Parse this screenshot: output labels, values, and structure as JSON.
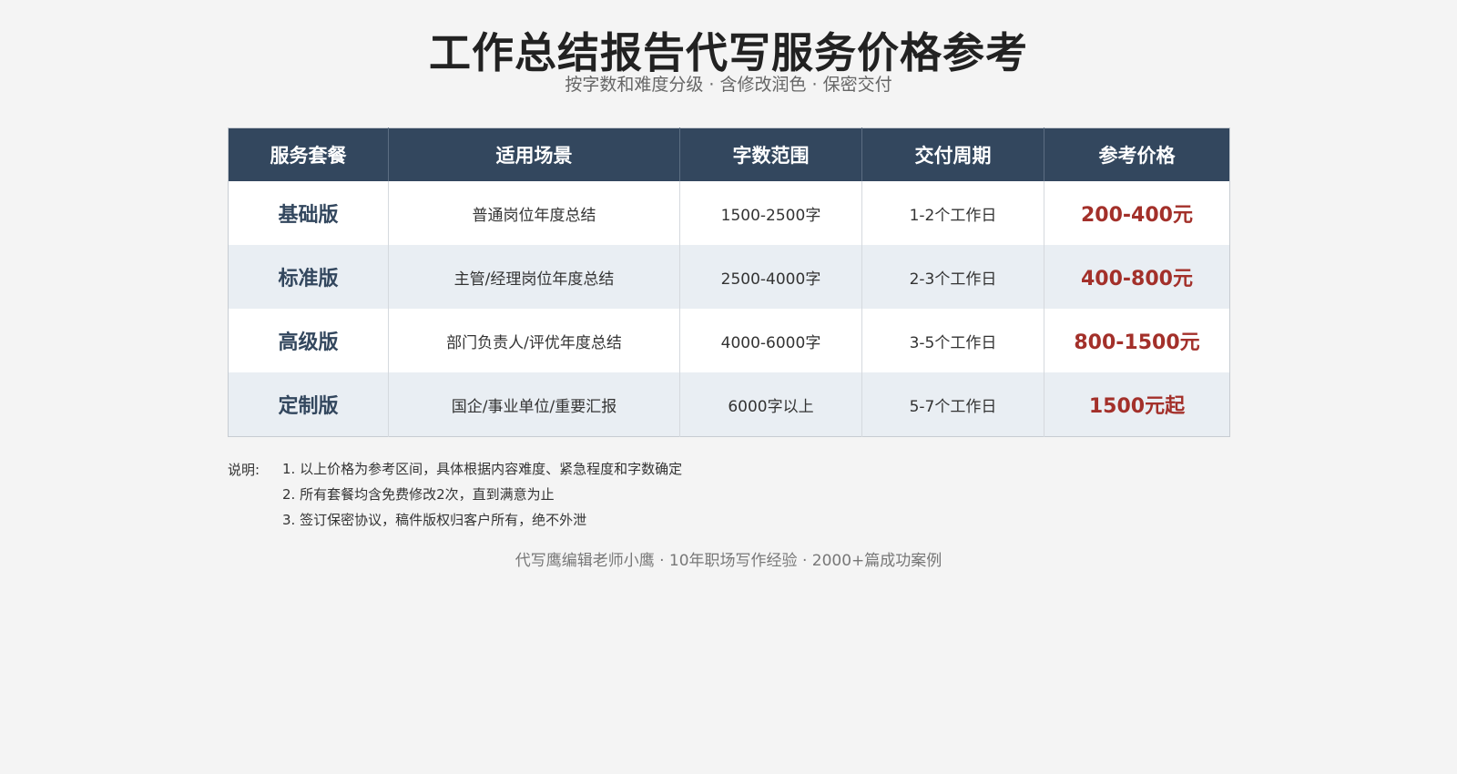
{
  "title": "工作总结报告代写服务价格参考",
  "subtitle": "按字数和难度分级 · 含修改润色 · 保密交付",
  "table": {
    "headers": [
      "服务套餐",
      "适用场景",
      "字数范围",
      "交付周期",
      "参考价格"
    ],
    "rows": [
      {
        "package": "基础版",
        "scenario": "普通岗位年度总结",
        "words": "1500-2500字",
        "delivery": "1-2个工作日",
        "price": "200-400元"
      },
      {
        "package": "标准版",
        "scenario": "主管/经理岗位年度总结",
        "words": "2500-4000字",
        "delivery": "2-3个工作日",
        "price": "400-800元"
      },
      {
        "package": "高级版",
        "scenario": "部门负责人/评优年度总结",
        "words": "4000-6000字",
        "delivery": "3-5个工作日",
        "price": "800-1500元"
      },
      {
        "package": "定制版",
        "scenario": "国企/事业单位/重要汇报",
        "words": "6000字以上",
        "delivery": "5-7个工作日",
        "price": "1500元起"
      }
    ]
  },
  "notes": {
    "label": "说明:",
    "items": [
      "1. 以上价格为参考区间，具体根据内容难度、紧急程度和字数确定",
      "2. 所有套餐均含免费修改2次，直到满意为止",
      "3. 签订保密协议，稿件版权归客户所有，绝不外泄"
    ]
  },
  "footer": "代写鹰编辑老师小鹰 · 10年职场写作经验 · 2000+篇成功案例",
  "colors": {
    "header_bg": "#33475e",
    "row_alt_bg": "#e9eef3",
    "price_color": "#a3302a"
  }
}
